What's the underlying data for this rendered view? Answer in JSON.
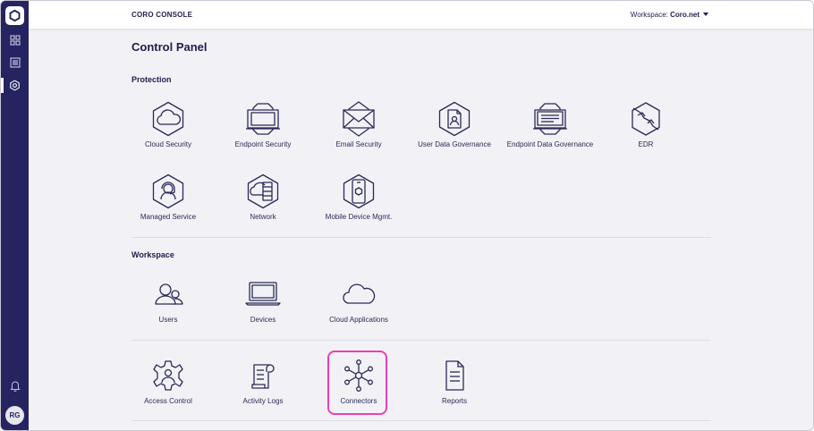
{
  "app": {
    "title": "CORO CONSOLE"
  },
  "workspace": {
    "label": "Workspace:",
    "value": "Coro.net"
  },
  "page": {
    "title": "Control Panel"
  },
  "sidebar": {
    "items": [
      {
        "icon": "dashboard-grid-icon"
      },
      {
        "icon": "list-document-icon"
      },
      {
        "icon": "settings-gear-icon"
      }
    ],
    "avatar": "RG"
  },
  "sections": {
    "protection": {
      "title": "Protection",
      "items": [
        {
          "label": "Cloud Security"
        },
        {
          "label": "Endpoint Security"
        },
        {
          "label": "Email Security"
        },
        {
          "label": "User Data Governance"
        },
        {
          "label": "Endpoint Data Governance"
        },
        {
          "label": "EDR"
        },
        {
          "label": "Managed Service"
        },
        {
          "label": "Network"
        },
        {
          "label": "Mobile Device Mgmt."
        }
      ]
    },
    "workspace": {
      "title": "Workspace",
      "items": [
        {
          "label": "Users"
        },
        {
          "label": "Devices"
        },
        {
          "label": "Cloud Applications"
        },
        {
          "label": "Access Control"
        },
        {
          "label": "Activity Logs"
        },
        {
          "label": "Connectors"
        },
        {
          "label": "Reports"
        }
      ]
    }
  },
  "colors": {
    "sidebar": "#262361",
    "text": "#1f1d4e",
    "highlight": "#ee3fb6",
    "background": "#f2f2f6"
  }
}
